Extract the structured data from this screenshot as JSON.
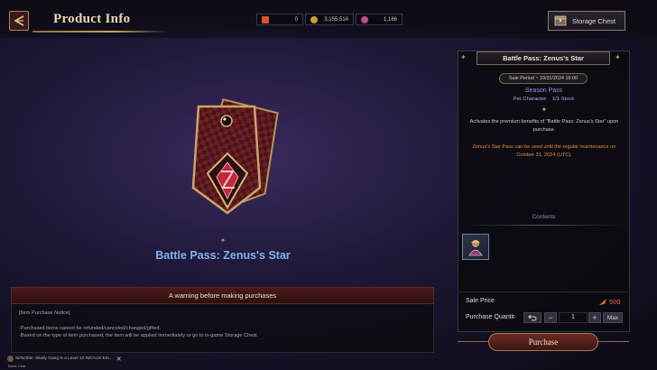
{
  "header": {
    "title": "Product Info",
    "storage_label": "Storage Chest"
  },
  "currencies": [
    {
      "name": "currency-1",
      "value": "0",
      "icon": "feather-icon",
      "color": "#d9532c"
    },
    {
      "name": "currency-2",
      "value": "3,155,514",
      "icon": "gold-coin-icon",
      "color": "#c9a13a"
    },
    {
      "name": "currency-3",
      "value": "1,166",
      "icon": "gem-icon",
      "color": "#c04a8a"
    }
  ],
  "item": {
    "name": "Battle Pass: Zenus's Star"
  },
  "warning": {
    "title": "A warning before making purchases",
    "lines": [
      "[Item Purchase Notice]",
      "",
      "·Purchased items cannot be refunded/canceled/changed/gifted.",
      "·Based on the type of item purchased, the item will be applied immediately or go to in-game Storage Chest."
    ]
  },
  "panel": {
    "title": "Battle Pass: Zenus's Star",
    "sale_period": "Sale Period ~ 10/31/2024 16:00",
    "type": "Season Pass",
    "per_character_label": "Per Character:",
    "stock": "1/1 Stock",
    "description": "Activates the premium benefits of \"Battle Pass: Zenus's Star\" upon purchase.",
    "notice": "Zenus's Star Pass can be used until the regular maintenance on October 31, 2024 (UTC).",
    "contents_label": "Contents",
    "sale_price_label": "Sale Price",
    "sale_price": "500",
    "quantity_label": "Purchase Quantit·",
    "quantity": "1",
    "max_label": "Max",
    "purchase_label": "Purchase"
  },
  "chat": {
    "message": "SirNOble: Skully Gang is a Level 12 NZ/AUS Em...",
    "tag": "Basic  Chat"
  },
  "colors": {
    "accent_gold": "#c8a468",
    "item_name_blue": "#7fb2e8",
    "notice_orange": "#e88e3a",
    "price_red": "#e3663e",
    "warning_red": "#4a1a1a"
  }
}
